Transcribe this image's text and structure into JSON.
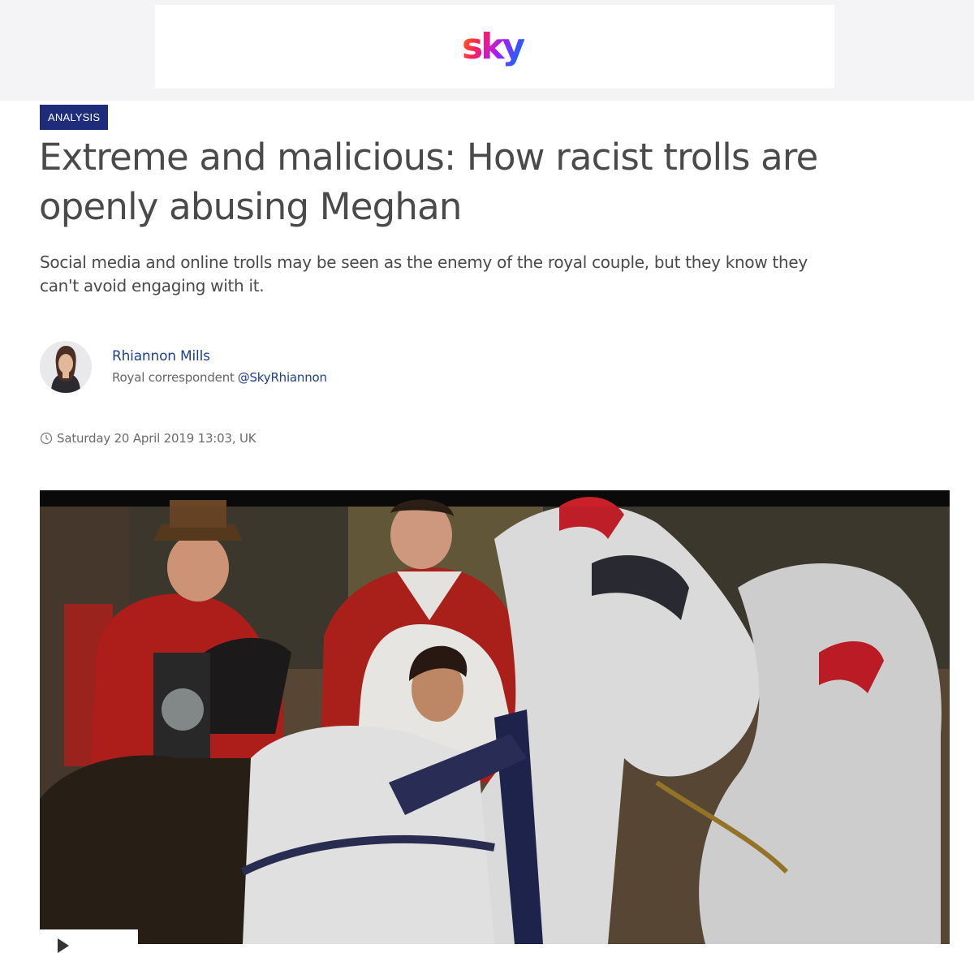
{
  "brand": {
    "logo_text": "sky",
    "logo_icon": "sky-logo"
  },
  "article": {
    "label": "ANALYSIS",
    "headline": "Extreme and malicious: How racist trolls are openly abusing Meghan",
    "standfirst": "Social media and online trolls may be seen as the enemy of the royal couple, but they know they can't avoid engaging with it.",
    "author": {
      "name": "Rhiannon Mills",
      "role": "Royal correspondent",
      "handle": "@SkyRhiannon"
    },
    "date": "Saturday 20 April 2019 13:03, UK"
  },
  "media": {
    "icon": "play-icon"
  },
  "colors": {
    "label_bg": "#1f2b7b",
    "link": "#1f3f8f",
    "masthead_bg": "#f4f4f6"
  }
}
